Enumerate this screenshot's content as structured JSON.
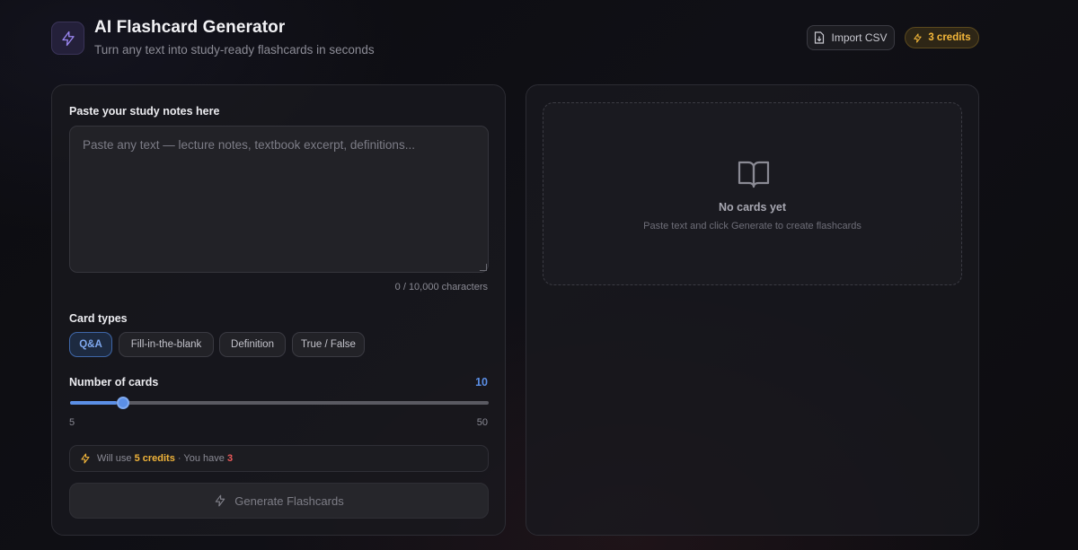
{
  "header": {
    "title": "AI Flashcard Generator",
    "subtitle": "Turn any text into study-ready flashcards in seconds",
    "app_icon": "lightning-icon",
    "import_label": "Import CSV",
    "credits_label": "3 credits"
  },
  "input_panel": {
    "notes_label": "Paste your study notes here",
    "notes_value": "",
    "notes_placeholder": "Paste any text — lecture notes, textbook excerpt, definitions...",
    "char_count": "0 / 10,000 characters",
    "card_types_label": "Card types",
    "card_types": [
      {
        "label": "Q&A",
        "selected": true
      },
      {
        "label": "Fill-in-the-blank",
        "selected": false
      },
      {
        "label": "Definition",
        "selected": false
      },
      {
        "label": "True / False",
        "selected": false
      }
    ],
    "num_cards_label": "Number of cards",
    "num_cards_value": "10",
    "slider": {
      "min": 5,
      "max": 50,
      "value": 10
    },
    "slider_min_label": "5",
    "slider_max_label": "50",
    "usage": {
      "prefix": "Will use",
      "credits": "5 credits",
      "middle": "· You have",
      "have": "3"
    },
    "generate_label": "Generate Flashcards"
  },
  "output_panel": {
    "empty_icon": "book-open-icon",
    "empty_title": "No cards yet",
    "empty_subtitle": "Paste text and click Generate to create flashcards"
  },
  "colors": {
    "accent_blue": "#5b8fe6",
    "credit_gold": "#f5b83a",
    "warning_red": "#ec5a5a",
    "icon_purple": "#9a86f0"
  }
}
